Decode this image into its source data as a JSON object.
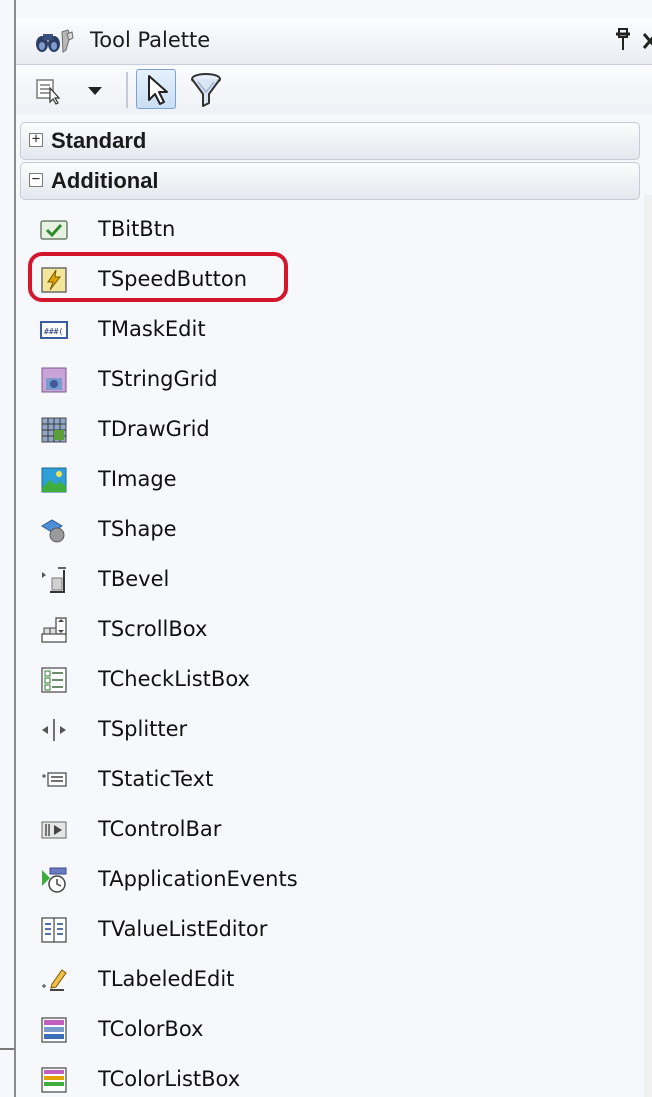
{
  "panel": {
    "title": "Tool Palette",
    "title_icon": "binoculars-tool-icon",
    "pin_glyph": "q",
    "close_glyph": "x"
  },
  "toolbar": {
    "buttons": [
      {
        "icon": "palette-options-icon"
      },
      {
        "icon": "dropdown-arrow-icon"
      },
      {
        "icon": "pointer-arrow-icon",
        "selected": true
      },
      {
        "icon": "filter-icon"
      }
    ]
  },
  "categories": [
    {
      "label": "Standard",
      "toggle": "+",
      "expanded": false
    },
    {
      "label": "Additional",
      "toggle": "−",
      "expanded": true
    }
  ],
  "items": [
    {
      "label": "TBitBtn",
      "icon": "bitbtn-icon"
    },
    {
      "label": "TSpeedButton",
      "icon": "speedbutton-icon"
    },
    {
      "label": "TMaskEdit",
      "icon": "maskedit-icon"
    },
    {
      "label": "TStringGrid",
      "icon": "stringgrid-icon"
    },
    {
      "label": "TDrawGrid",
      "icon": "drawgrid-icon"
    },
    {
      "label": "TImage",
      "icon": "image-icon"
    },
    {
      "label": "TShape",
      "icon": "shape-icon"
    },
    {
      "label": "TBevel",
      "icon": "bevel-icon"
    },
    {
      "label": "TScrollBox",
      "icon": "scrollbox-icon"
    },
    {
      "label": "TCheckListBox",
      "icon": "checklistbox-icon"
    },
    {
      "label": "TSplitter",
      "icon": "splitter-icon"
    },
    {
      "label": "TStaticText",
      "icon": "statictext-icon"
    },
    {
      "label": "TControlBar",
      "icon": "controlbar-icon"
    },
    {
      "label": "TApplicationEvents",
      "icon": "applicationevents-icon"
    },
    {
      "label": "TValueListEditor",
      "icon": "valuelisteditor-icon"
    },
    {
      "label": "TLabeledEdit",
      "icon": "labelededit-icon"
    },
    {
      "label": "TColorBox",
      "icon": "colorbox-icon"
    },
    {
      "label": "TColorListBox",
      "icon": "colorlistbox-icon"
    }
  ],
  "highlighted_item": "TSpeedButton",
  "colors": {
    "highlight": "#d3162c",
    "selected_button": "#c9dff5"
  }
}
